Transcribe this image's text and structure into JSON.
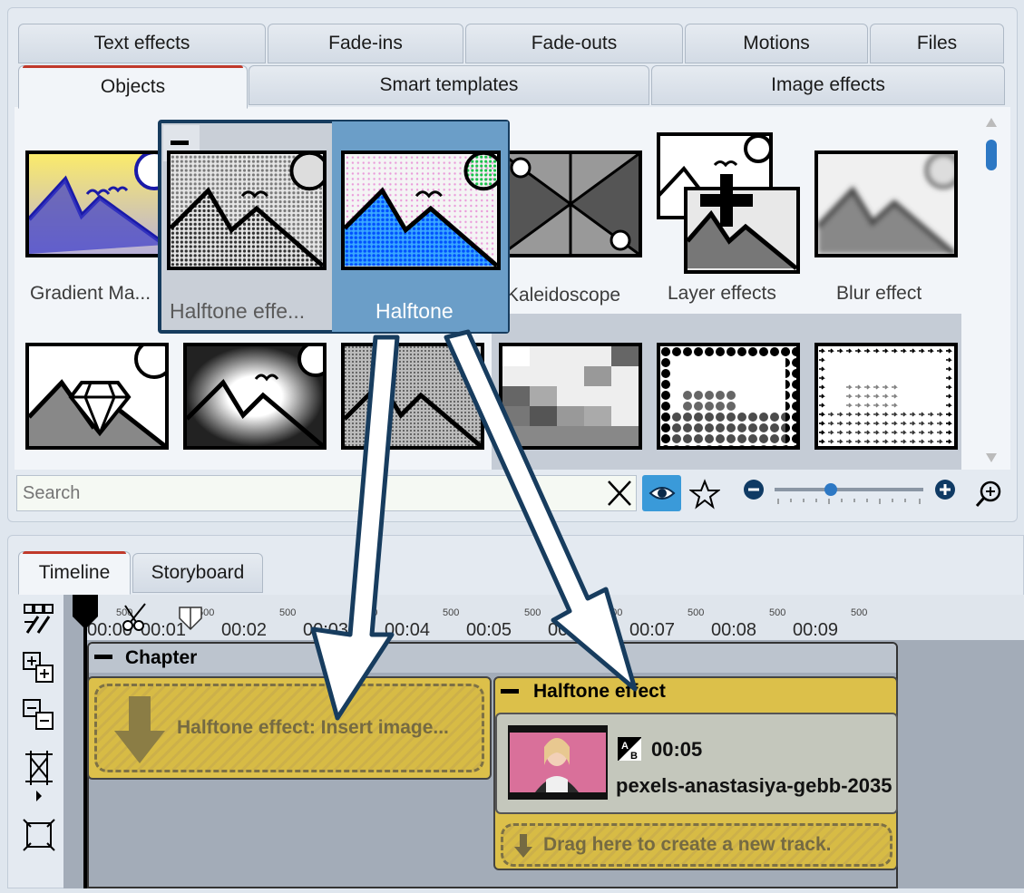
{
  "tabs_row1": [
    "Text effects",
    "Fade-ins",
    "Fade-outs",
    "Motions",
    "Files"
  ],
  "tabs_row2": [
    "Objects",
    "Smart templates",
    "Image effects"
  ],
  "effects_row1": [
    {
      "label": "Gradient Ma...",
      "icon": "gradient-mask-icon"
    },
    {
      "label": "Kaleidoscope",
      "icon": "kaleidoscope-icon"
    },
    {
      "label": "Layer effects",
      "icon": "layer-effects-icon"
    },
    {
      "label": "Blur effect",
      "icon": "blur-effect-icon"
    }
  ],
  "popup": {
    "items": [
      {
        "label": "Halftone effe...",
        "icon": "halftone-effect-icon"
      },
      {
        "label": "Halftone",
        "icon": "halftone-color-icon"
      }
    ]
  },
  "search": {
    "placeholder": "Search"
  },
  "bottom_tabs": [
    "Timeline",
    "Storyboard"
  ],
  "ruler": {
    "labels": [
      "00:00",
      "00:01",
      "00:02",
      "00:03",
      "00:04",
      "00:05",
      "00:06",
      "00:07",
      "00:08",
      "00:09"
    ],
    "minor": "500"
  },
  "timeline": {
    "chapter": "Chapter",
    "insert_placeholder": "Halftone effect: Insert image...",
    "effect_track": "Halftone effect",
    "clip": {
      "duration": "00:05",
      "name": "pexels-anastasiya-gebb-2035"
    },
    "new_track": "Drag here to create a new track."
  },
  "colors": {
    "accent": "#3a9ad9",
    "selection": "#6b9ec8",
    "track": "#dcc04a",
    "arrow_stroke": "#173c5e"
  }
}
